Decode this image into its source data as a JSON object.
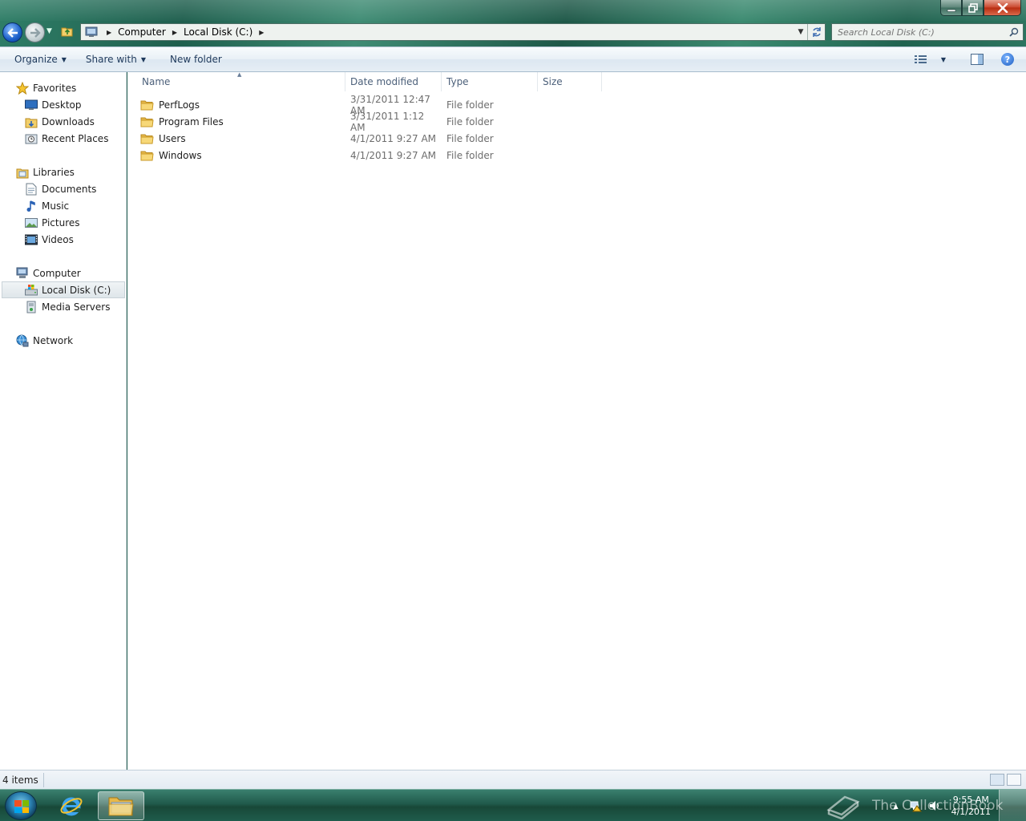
{
  "window": {
    "minimize_label": "–",
    "maximize_label": "⧉",
    "close_label": "✕"
  },
  "address": {
    "crumbs": [
      "Computer",
      "Local Disk (C:)"
    ],
    "search_placeholder": "Search Local Disk (C:)"
  },
  "toolbar": {
    "organize": "Organize",
    "share_with": "Share with",
    "new_folder": "New folder"
  },
  "nav": {
    "favorites": {
      "label": "Favorites",
      "items": [
        "Desktop",
        "Downloads",
        "Recent Places"
      ]
    },
    "libraries": {
      "label": "Libraries",
      "items": [
        "Documents",
        "Music",
        "Pictures",
        "Videos"
      ]
    },
    "computer": {
      "label": "Computer",
      "items": [
        "Local Disk (C:)",
        "Media Servers"
      ],
      "selected": "Local Disk (C:)"
    },
    "network": {
      "label": "Network"
    }
  },
  "columns": {
    "name": "Name",
    "date": "Date modified",
    "type": "Type",
    "size": "Size"
  },
  "files": [
    {
      "name": "PerfLogs",
      "date": "3/31/2011 12:47 AM",
      "type": "File folder"
    },
    {
      "name": "Program Files",
      "date": "3/31/2011 1:12 AM",
      "type": "File folder"
    },
    {
      "name": "Users",
      "date": "4/1/2011 9:27 AM",
      "type": "File folder"
    },
    {
      "name": "Windows",
      "date": "4/1/2011 9:27 AM",
      "type": "File folder"
    }
  ],
  "status": {
    "item_count": "4 items"
  },
  "taskbar": {
    "time": "9:55 AM",
    "date": "4/1/2011",
    "watermark": "The CollectionBook"
  },
  "colors": {
    "glass": "#2f7e67",
    "link_text": "#1e395b",
    "folder": "#f2cf6a"
  }
}
